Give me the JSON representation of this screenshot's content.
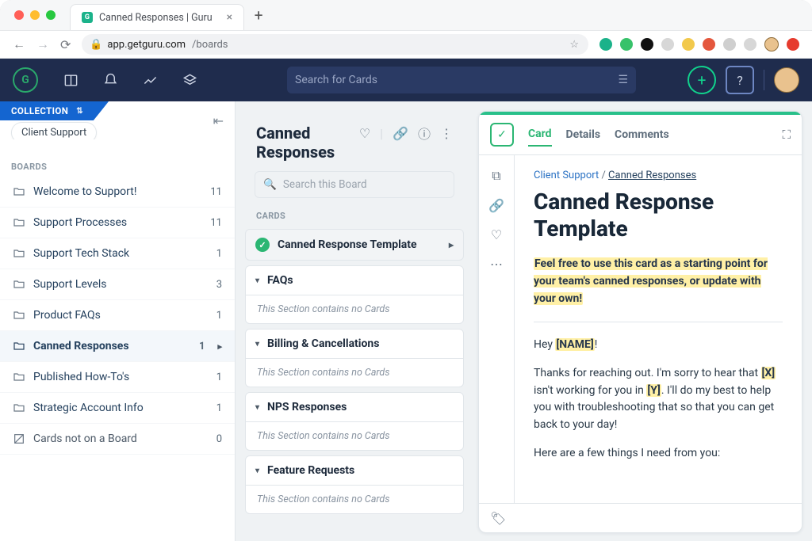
{
  "browser": {
    "tab_title": "Canned Responses | Guru",
    "url_host": "app.getguru.com",
    "url_path": "/boards"
  },
  "appbar": {
    "search_placeholder": "Search for Cards",
    "help_label": "?"
  },
  "sidebar": {
    "collection_label": "COLLECTION",
    "collection_name": "Client Support",
    "boards_label": "BOARDS",
    "items": [
      {
        "label": "Welcome to Support!",
        "count": "11"
      },
      {
        "label": "Support Processes",
        "count": "11"
      },
      {
        "label": "Support Tech Stack",
        "count": "1"
      },
      {
        "label": "Support Levels",
        "count": "3"
      },
      {
        "label": "Product FAQs",
        "count": "1"
      },
      {
        "label": "Canned Responses",
        "count": "1"
      },
      {
        "label": "Published How-To's",
        "count": "1"
      },
      {
        "label": "Strategic Account Info",
        "count": "1"
      }
    ],
    "unassigned": {
      "label": "Cards not on a Board",
      "count": "0"
    }
  },
  "board": {
    "title": "Canned Responses",
    "search_placeholder": "Search this Board",
    "cards_label": "CARDS",
    "empty_text": "This Section contains no Cards",
    "sections": [
      {
        "label": "Canned Response Template",
        "selected": true
      },
      {
        "label": "FAQs"
      },
      {
        "label": "Billing & Cancellations"
      },
      {
        "label": "NPS Responses"
      },
      {
        "label": "Feature Requests"
      }
    ]
  },
  "card": {
    "tabs": {
      "card": "Card",
      "details": "Details",
      "comments": "Comments"
    },
    "breadcrumb": {
      "collection": "Client Support",
      "board": "Canned Responses"
    },
    "title": "Canned Response Template",
    "intro": "Feel free to use this card as a starting point for your team's canned responses, or update with your own!",
    "greeting_prefix": "Hey ",
    "greeting_var": "[NAME]",
    "greeting_suffix": "!",
    "body1_a": "Thanks for reaching out. I'm sorry to hear that ",
    "body1_var1": "[X]",
    "body1_b": " isn't working for you in ",
    "body1_var2": "[Y]",
    "body1_c": ". I'll do my best to help you with troubleshooting that so that you can get back to your day!",
    "body2": "Here are a few things I need from you:"
  }
}
